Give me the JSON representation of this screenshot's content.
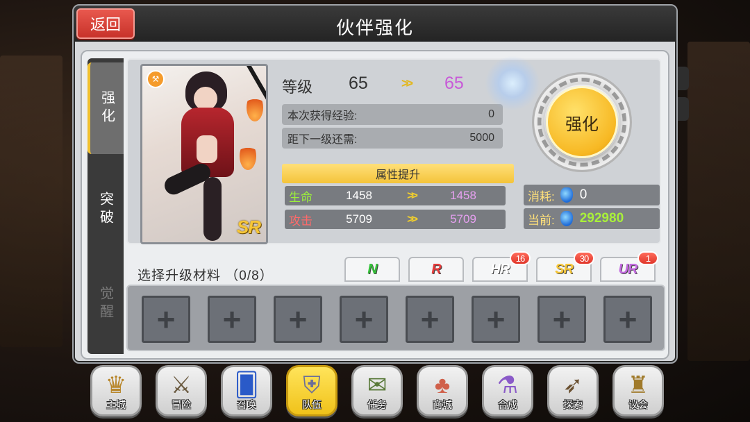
{
  "window": {
    "title": "伙伴强化",
    "back_label": "返回"
  },
  "tabs": [
    {
      "label": "强化",
      "state": "active"
    },
    {
      "label": "突破",
      "state": "normal"
    },
    {
      "label": "觉醒",
      "state": "disabled"
    }
  ],
  "card": {
    "rarity": "SR",
    "rank_icon": "weapon-icon"
  },
  "level": {
    "label": "等级",
    "current": "65",
    "arrow": ">>",
    "next": "65"
  },
  "exp": {
    "gained_label": "本次获得经验:",
    "gained_value": "0",
    "remain_label": "距下一级还需:",
    "remain_value": "5000"
  },
  "attributes": {
    "header": "属性提升",
    "rows": [
      {
        "name": "生命",
        "name_color": "#9cf03a",
        "current": "1458",
        "arrow": ">>",
        "next": "1458"
      },
      {
        "name": "攻击",
        "name_color": "#ff6a6a",
        "current": "5709",
        "arrow": ">>",
        "next": "5709"
      }
    ]
  },
  "enhance_button": {
    "label": "强化"
  },
  "cost": {
    "consume_label": "消耗:",
    "consume_value": "0",
    "current_label": "当前:",
    "current_value": "292980"
  },
  "materials": {
    "label": "选择升级材料  （0/8）",
    "filters": [
      {
        "label": "N",
        "color": "#35c23a",
        "badge": ""
      },
      {
        "label": "R",
        "color": "#e53a3a",
        "badge": ""
      },
      {
        "label": "HR",
        "color": "#ffffff",
        "badge": "16"
      },
      {
        "label": "SR",
        "color": "#f6c638",
        "badge": "30"
      },
      {
        "label": "UR",
        "color": "#c36ae0",
        "badge": "1"
      }
    ],
    "slots": [
      "+",
      "+",
      "+",
      "+",
      "+",
      "+",
      "+",
      "+"
    ]
  },
  "nav": [
    {
      "label": "主城",
      "icon": "crown-icon",
      "glyph": "♛",
      "active": false
    },
    {
      "label": "冒险",
      "icon": "crossed-swords-icon",
      "glyph": "⚔",
      "active": false
    },
    {
      "label": "召唤",
      "icon": "summon-card-icon",
      "glyph": "🂠",
      "active": false
    },
    {
      "label": "队伍",
      "icon": "winged-shield-icon",
      "glyph": "⛨",
      "active": true
    },
    {
      "label": "任务",
      "icon": "quest-scroll-icon",
      "glyph": "✉",
      "active": false
    },
    {
      "label": "商城",
      "icon": "shop-tree-icon",
      "glyph": "♣",
      "active": false
    },
    {
      "label": "合成",
      "icon": "potion-flask-icon",
      "glyph": "⚗",
      "active": false
    },
    {
      "label": "探索",
      "icon": "bow-icon",
      "glyph": "➶",
      "active": false
    },
    {
      "label": "议会",
      "icon": "council-crest-icon",
      "glyph": "♜",
      "active": false
    }
  ]
}
